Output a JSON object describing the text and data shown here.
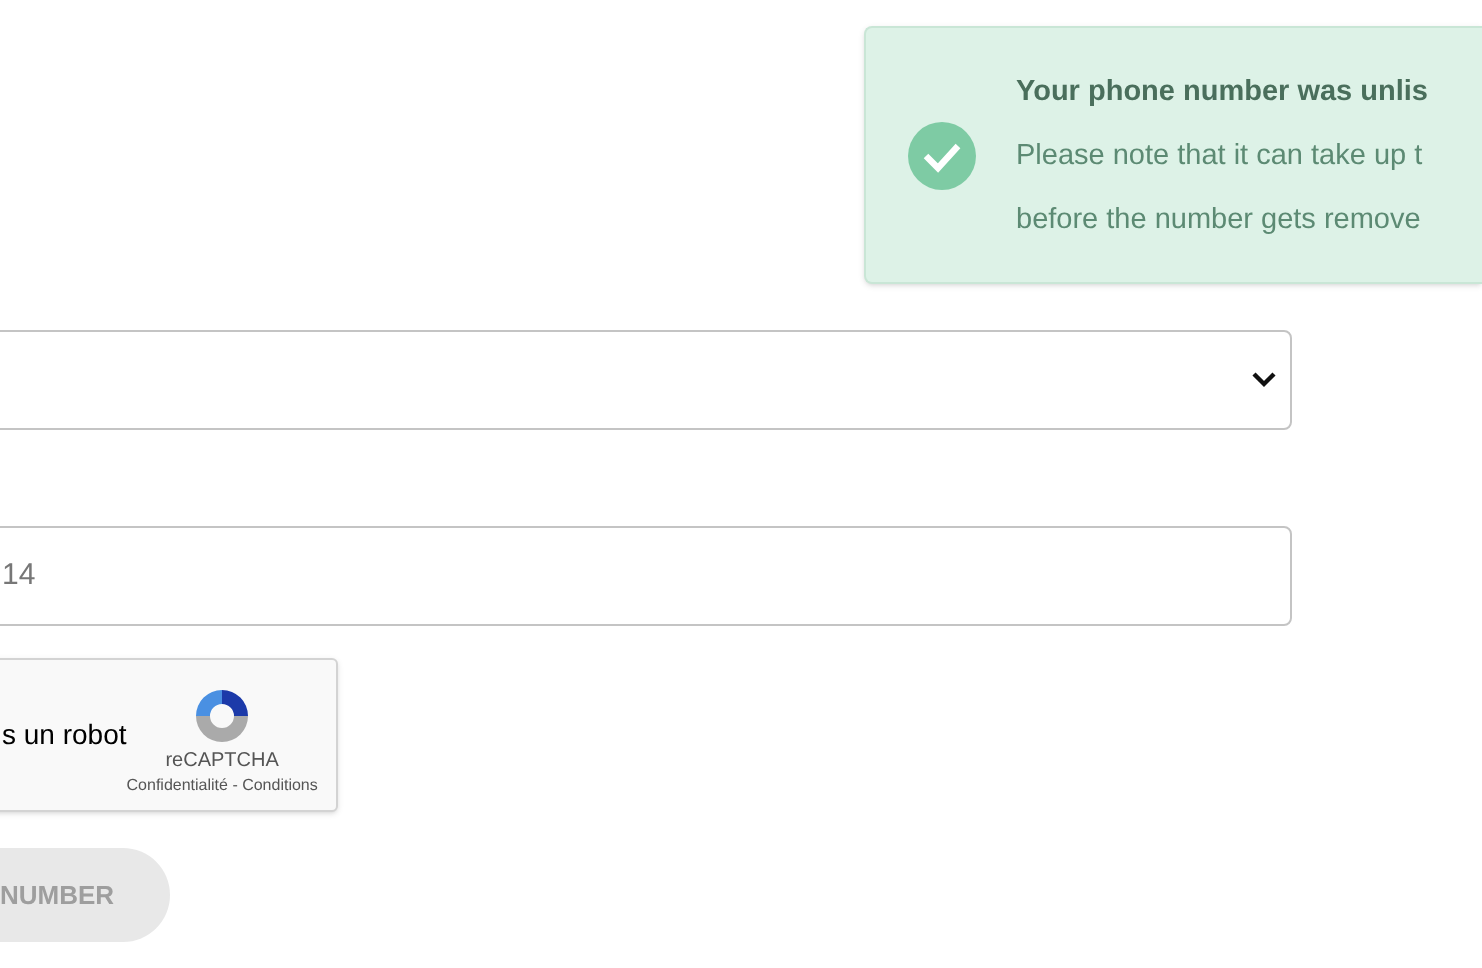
{
  "toast": {
    "title": "Your phone number was unlis",
    "lines": [
      "Please note that it can take up t",
      "before the number gets remove"
    ]
  },
  "phone_field": {
    "value": "14"
  },
  "captcha": {
    "label": "s un robot",
    "brand": "reCAPTCHA",
    "links": "Confidentialité - Conditions"
  },
  "submit_button": {
    "label": "NUMBER",
    "disabled": true
  }
}
